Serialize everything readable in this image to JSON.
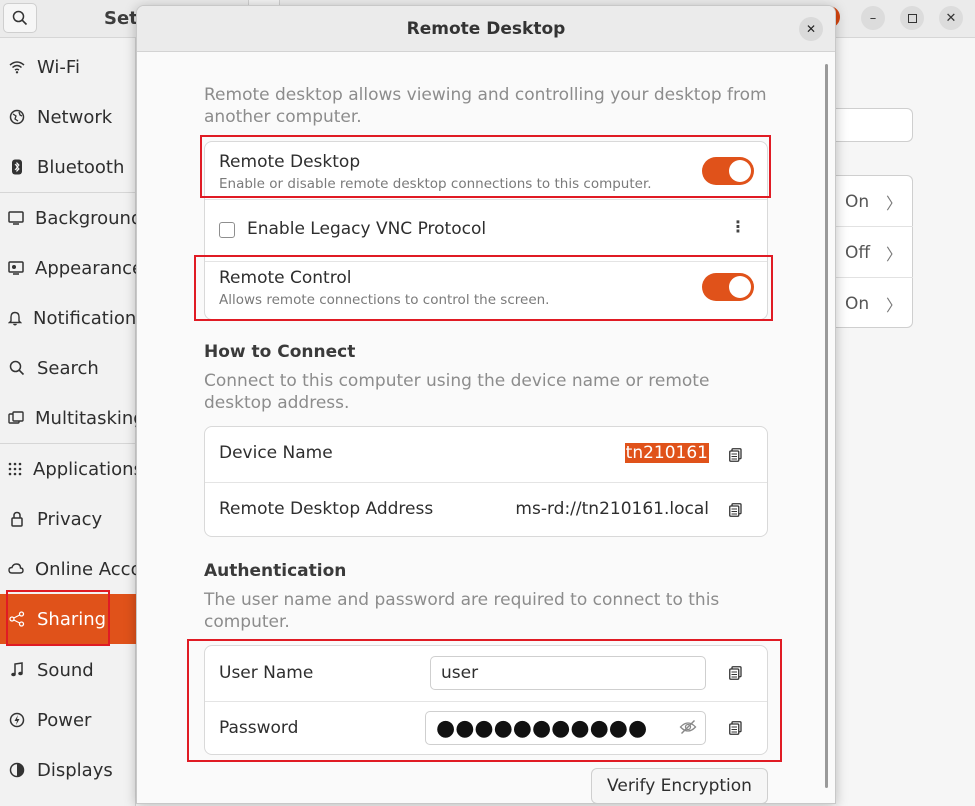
{
  "background": {
    "title": "Set",
    "sidebar": {
      "items": [
        {
          "label": "Wi-Fi",
          "icon": "wifi-icon"
        },
        {
          "label": "Network",
          "icon": "network-icon"
        },
        {
          "label": "Bluetooth",
          "icon": "bluetooth-icon"
        },
        {
          "label": "Background",
          "icon": "background-icon"
        },
        {
          "label": "Appearance",
          "icon": "appearance-icon"
        },
        {
          "label": "Notifications",
          "icon": "bell-icon"
        },
        {
          "label": "Search",
          "icon": "search-icon"
        },
        {
          "label": "Multitasking",
          "icon": "multitasking-icon"
        },
        {
          "label": "Applications",
          "icon": "apps-grid-icon"
        },
        {
          "label": "Privacy",
          "icon": "lock-icon"
        },
        {
          "label": "Online Accounts",
          "icon": "cloud-icon"
        },
        {
          "label": "Sharing",
          "icon": "share-icon",
          "active": true
        },
        {
          "label": "Sound",
          "icon": "music-note-icon"
        },
        {
          "label": "Power",
          "icon": "power-icon"
        },
        {
          "label": "Displays",
          "icon": "display-icon"
        }
      ]
    },
    "list_values": [
      "On",
      "Off",
      "On"
    ]
  },
  "dialog": {
    "title": "Remote Desktop",
    "intro": "Remote desktop allows viewing and controlling your desktop from another computer.",
    "remote_desktop": {
      "title": "Remote Desktop",
      "subtitle": "Enable or disable remote desktop connections to this computer.",
      "enabled": true
    },
    "legacy_vnc": {
      "label": "Enable Legacy VNC Protocol",
      "checked": false
    },
    "remote_control": {
      "title": "Remote Control",
      "subtitle": "Allows remote connections to control the screen.",
      "enabled": true
    },
    "how_to_connect": {
      "heading": "How to Connect",
      "description": "Connect to this computer using the device name or remote desktop address.",
      "device_name_label": "Device Name",
      "device_name_value": "tn210161",
      "address_label": "Remote Desktop Address",
      "address_value": "ms-rd://tn210161.local"
    },
    "authentication": {
      "heading": "Authentication",
      "description": "The user name and password are required to connect to this computer.",
      "username_label": "User Name",
      "username_value": "user",
      "password_label": "Password",
      "password_value": "●●●●●●●●●●●"
    },
    "verify_button": "Verify Encryption"
  },
  "colors": {
    "accent": "#e0521a",
    "highlight": "#e01b24"
  }
}
